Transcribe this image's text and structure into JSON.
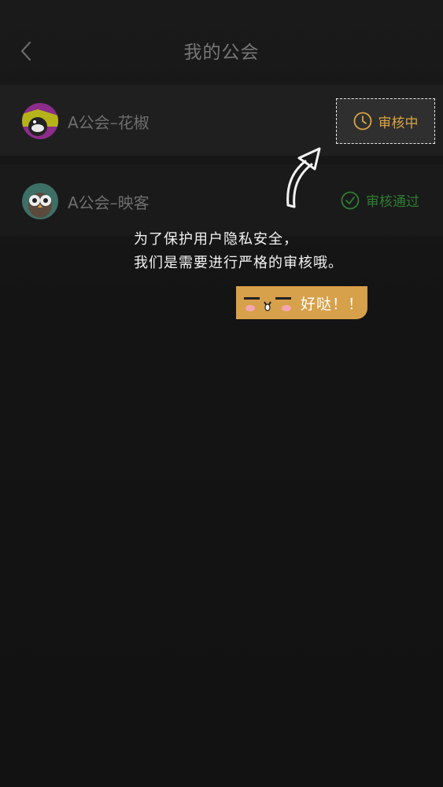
{
  "header": {
    "title": "我的公会"
  },
  "guilds": [
    {
      "name": "A公会–花椒",
      "status": "审核中"
    },
    {
      "name": "A公会–映客",
      "status": "审核通过"
    }
  ],
  "tip": {
    "line1": "为了保护用户隐私安全，",
    "line2": "我们是需要进行严格的审核哦。",
    "button_label": "好哒！！"
  },
  "colors": {
    "pending": "#d9a443",
    "approved": "#2e7d32",
    "button": "#d7a04a"
  }
}
